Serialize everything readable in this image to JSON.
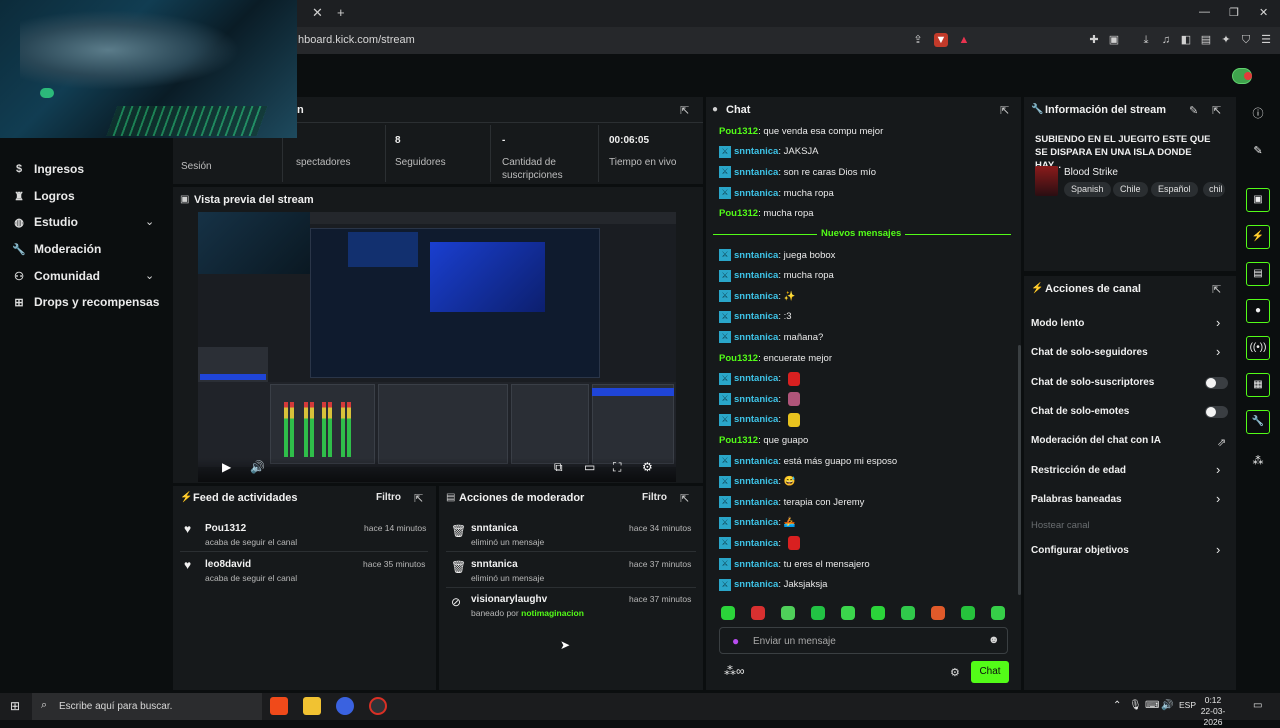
{
  "browser": {
    "url": "hboard.kick.com/stream",
    "tab_close": "✕",
    "new_tab": "+",
    "win_min": "—",
    "win_max": "❐",
    "win_close": "✕"
  },
  "nav": {
    "items": [
      {
        "label": "Ingresos",
        "icon": "dollar-icon"
      },
      {
        "label": "Logros",
        "icon": "trophy-icon"
      },
      {
        "label": "Estudio",
        "icon": "globe-icon"
      },
      {
        "label": "Moderación",
        "icon": "wrench-icon"
      },
      {
        "label": "Comunidad",
        "icon": "people-icon"
      },
      {
        "label": "Drops y recompensas",
        "icon": "gift-icon"
      }
    ]
  },
  "session": {
    "title_fragment": "n",
    "stats": [
      {
        "label_fragment": "Sesión",
        "value": ""
      },
      {
        "label": "Espectadores",
        "label_fragment": "spectadores",
        "value": ""
      },
      {
        "label": "Seguidores",
        "value": "8"
      },
      {
        "label": "Cantidad de suscripciones",
        "value": "-"
      },
      {
        "label": "Tiempo en vivo",
        "value": "00:06:05"
      }
    ]
  },
  "preview": {
    "title": "Vista previa del stream"
  },
  "activity": {
    "title": "Feed de actividades",
    "filter": "Filtro",
    "items": [
      {
        "name": "Pou1312",
        "sub": "acaba de seguir el canal",
        "time": "hace 14 minutos"
      },
      {
        "name": "leo8david",
        "sub": "acaba de seguir el canal",
        "time": "hace 35 minutos"
      }
    ]
  },
  "modactions": {
    "title": "Acciones de moderador",
    "filter": "Filtro",
    "items": [
      {
        "name": "snntanica",
        "sub": "eliminó un mensaje",
        "time": "hace 34 minutos",
        "icon": "trash-icon"
      },
      {
        "name": "snntanica",
        "sub": "eliminó un mensaje",
        "time": "hace 37 minutos",
        "icon": "trash-icon"
      },
      {
        "name": "visionarylaughv",
        "sub": "baneado por",
        "sub_user": "notimaginacion",
        "time": "hace 37 minutos",
        "icon": "ban-icon"
      }
    ]
  },
  "chat": {
    "title": "Chat",
    "new_messages": "Nuevos mensajes",
    "input_placeholder": "Enviar un mensaje",
    "send_label": "Chat",
    "user_colors": {
      "Pou1312": "#53fc18",
      "snntanica": "#3ec4e8"
    },
    "messages_before": [
      {
        "user": "Pou1312",
        "text": "que venda esa compu mejor",
        "badge": false
      },
      {
        "user": "snntanica",
        "text": "JAKSJA",
        "badge": true
      },
      {
        "user": "snntanica",
        "text": "son re caras Dios mío",
        "badge": true
      },
      {
        "user": "snntanica",
        "text": "mucha ropa",
        "badge": true
      },
      {
        "user": "Pou1312",
        "text": "mucha ropa",
        "badge": false
      }
    ],
    "messages_after": [
      {
        "user": "snntanica",
        "text": "juega bobox",
        "badge": true
      },
      {
        "user": "snntanica",
        "text": "mucha ropa",
        "badge": true
      },
      {
        "user": "snntanica",
        "text": "✨",
        "badge": true
      },
      {
        "user": "snntanica",
        "text": ":3",
        "badge": true
      },
      {
        "user": "snntanica",
        "text": "mañana?",
        "badge": true
      },
      {
        "user": "Pou1312",
        "text": "encuerate mejor",
        "badge": false
      },
      {
        "user": "snntanica",
        "text": "",
        "badge": true,
        "emote": "#d92020"
      },
      {
        "user": "snntanica",
        "text": "",
        "badge": true,
        "emote": "#b0557a"
      },
      {
        "user": "snntanica",
        "text": "",
        "badge": true,
        "emote": "#e8c21e"
      },
      {
        "user": "Pou1312",
        "text": "que guapo",
        "badge": false
      },
      {
        "user": "snntanica",
        "text": "está más guapo mi esposo",
        "badge": true
      },
      {
        "user": "snntanica",
        "text": "😅",
        "badge": true
      },
      {
        "user": "snntanica",
        "text": "terapia con Jeremy",
        "badge": true
      },
      {
        "user": "snntanica",
        "text": "🚣",
        "badge": true
      },
      {
        "user": "snntanica",
        "text": "",
        "badge": true,
        "emote": "#d92020"
      },
      {
        "user": "snntanica",
        "text": "tu eres el mensajero",
        "badge": true
      },
      {
        "user": "snntanica",
        "text": "Jaksjaksja",
        "badge": true
      }
    ],
    "emote_bar": [
      "#2bd43a",
      "#d83030",
      "#4fd05a",
      "#22c244",
      "#3bd64c",
      "#2bd43a",
      "#30c94b",
      "#e05a2a",
      "#26c23c",
      "#36cf48"
    ]
  },
  "stream_info": {
    "title": "Información del stream",
    "stream_title": "SUBIENDO EN EL JUEGITO ESTE QUE SE DISPARA EN UNA ISLA DONDE HAY...",
    "category": "Blood Strike",
    "tags": [
      "Spanish",
      "Chile",
      "Español",
      "chil"
    ]
  },
  "channel_actions": {
    "title": "Acciones de canal",
    "items": [
      {
        "label": "Modo lento",
        "control": "chevron"
      },
      {
        "label": "Chat de solo-seguidores",
        "control": "chevron"
      },
      {
        "label": "Chat de solo-suscriptores",
        "control": "toggle"
      },
      {
        "label": "Chat de solo-emotes",
        "control": "toggle"
      },
      {
        "label": "Moderación del chat con IA",
        "control": "external"
      },
      {
        "label": "Restricción de edad",
        "control": "chevron"
      },
      {
        "label": "Palabras baneadas",
        "control": "chevron"
      },
      {
        "label": "Hostear canal",
        "control": "disabled"
      },
      {
        "label": "Configurar objetivos",
        "control": "chevron"
      }
    ]
  },
  "taskbar": {
    "search_placeholder": "Escribe aquí para buscar.",
    "lang": "ESP",
    "time": "0:12",
    "date": "22-03-2026"
  }
}
